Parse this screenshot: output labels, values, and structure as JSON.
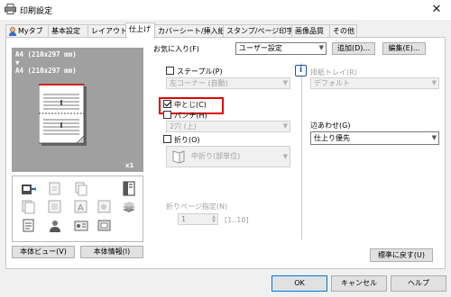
{
  "window": {
    "title": "印刷設定",
    "close_glyph": "✕"
  },
  "tabs": [
    {
      "label": "Myタブ"
    },
    {
      "label": "基本設定"
    },
    {
      "label": "レイアウト"
    },
    {
      "label": "仕上げ"
    },
    {
      "label": "カバーシート/挿入紙"
    },
    {
      "label": "スタンプ/ページ印字"
    },
    {
      "label": "画像品質"
    },
    {
      "label": "その他"
    }
  ],
  "active_tab": "仕上げ",
  "preview": {
    "line1": "A4 (210x297 mm)",
    "arrow": "▼",
    "line2": "A4 (210x297 mm)",
    "zoom": "x1"
  },
  "left_buttons": {
    "view": "本体ビュー(V)",
    "info": "本体情報(I)"
  },
  "favorites": {
    "label": "お気に入り(F)",
    "value": "ユーザー設定",
    "add": "追加(D)...",
    "edit": "編集(E)..."
  },
  "staple": {
    "label": "ステープル(P)",
    "value": "左コーナー (自動)"
  },
  "saddle": {
    "label": "中とじ(C)",
    "checked": true
  },
  "punch": {
    "label": "パンチ(H)",
    "value": "2穴 (上)"
  },
  "fold": {
    "label": "折り(O)",
    "value": "中折り(部単位)"
  },
  "fold_page": {
    "label": "折りページ指定(N)",
    "value": "1",
    "range": "[1..10]"
  },
  "output_tray": {
    "label": "排紙トレイ(R)",
    "value": "デフォルト"
  },
  "alignment": {
    "label": "辺あわせ(G)",
    "value": "仕上り優先"
  },
  "restore_button": "標準に戻す(U)",
  "footer": {
    "ok": "OK",
    "cancel": "キャンセル",
    "help": "ヘルプ"
  },
  "colors": {
    "highlight": "#e00000",
    "preview_bg": "#a0a0a0"
  }
}
